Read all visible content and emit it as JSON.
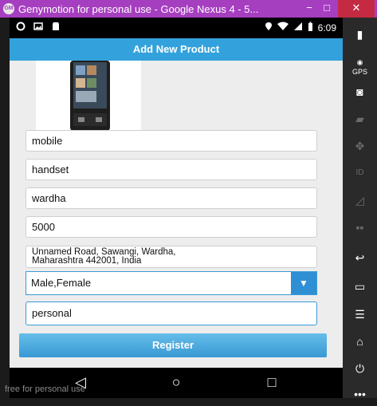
{
  "window": {
    "title": "Genymotion for personal use - Google Nexus 4 - 5...",
    "app_icon": "genymotion-icon",
    "minimize": "−",
    "maximize": "□",
    "close": "✕",
    "title_bar_color": "#a63ec0",
    "close_color": "#c42b42"
  },
  "statusbar": {
    "time": "6:09",
    "left_icons": [
      "settings-icon",
      "image-icon",
      "sd-card-icon"
    ],
    "right_icons": [
      "location-icon",
      "wifi-icon",
      "signal-icon",
      "battery-icon"
    ]
  },
  "actionbar": {
    "title": "Add New Product",
    "color": "#33a2dc"
  },
  "product": {
    "image": "phone-product-image"
  },
  "form": {
    "name": "mobile",
    "category": "handset",
    "city": "wardha",
    "price": "5000",
    "address_line1": "Unnamed Road, Sawangi, Wardha,",
    "address_line2": "Maharashtra 442001, India",
    "gender": "Male,Female",
    "type": "personal"
  },
  "register_label": "Register",
  "navbar": {
    "back": "◁",
    "home": "○",
    "recents": "□"
  },
  "watermark": "free for personal use",
  "side_toolbar": [
    {
      "icon": "battery-icon",
      "label": "",
      "enabled": true
    },
    {
      "icon": "gps-icon",
      "label": "GPS",
      "enabled": true
    },
    {
      "icon": "webcam-icon",
      "label": "",
      "enabled": true
    },
    {
      "icon": "clapperboard-icon",
      "label": "",
      "enabled": false
    },
    {
      "icon": "dpad-icon",
      "label": "",
      "enabled": false
    },
    {
      "icon": "id-icon",
      "label": "ID",
      "enabled": false
    },
    {
      "icon": "cast-icon",
      "label": "",
      "enabled": false
    },
    {
      "icon": "sms-icon",
      "label": "",
      "enabled": false
    },
    {
      "icon": "back-icon",
      "label": "",
      "enabled": true
    },
    {
      "icon": "recent-apps-icon",
      "label": "",
      "enabled": true
    },
    {
      "icon": "menu-icon",
      "label": "",
      "enabled": true
    },
    {
      "icon": "home-icon",
      "label": "",
      "enabled": true
    },
    {
      "icon": "power-icon",
      "label": "",
      "enabled": true
    },
    {
      "icon": "more-icon",
      "label": "",
      "enabled": true
    }
  ]
}
